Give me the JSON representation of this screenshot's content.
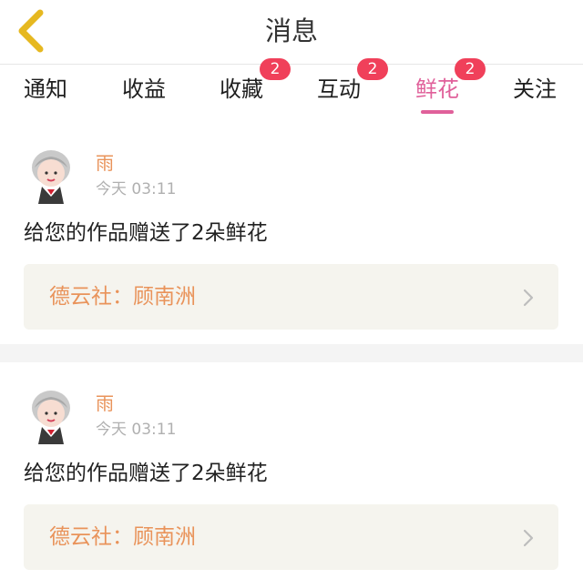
{
  "header": {
    "title": "消息"
  },
  "tabs": [
    {
      "label": "通知",
      "badge": ""
    },
    {
      "label": "收益",
      "badge": ""
    },
    {
      "label": "收藏",
      "badge": "2"
    },
    {
      "label": "互动",
      "badge": "2"
    },
    {
      "label": "鲜花",
      "badge": "2",
      "active": true
    },
    {
      "label": "关注",
      "badge": ""
    }
  ],
  "messages": [
    {
      "user": "雨",
      "time": "今天 03:11",
      "text": "给您的作品赠送了2朵鲜花",
      "work": "德云社：顾南洲"
    },
    {
      "user": "雨",
      "time": "今天 03:11",
      "text": "给您的作品赠送了2朵鲜花",
      "work": "德云社：顾南洲"
    }
  ],
  "colors": {
    "accent": "#e0609a",
    "badge": "#f0405a",
    "username": "#e9935a",
    "work_box": "#f5f4ee",
    "back_arrow": "#e6b820"
  },
  "icons": {
    "back": "back-chevron-icon",
    "arrow": "chevron-right-icon",
    "avatar": "avatar"
  }
}
